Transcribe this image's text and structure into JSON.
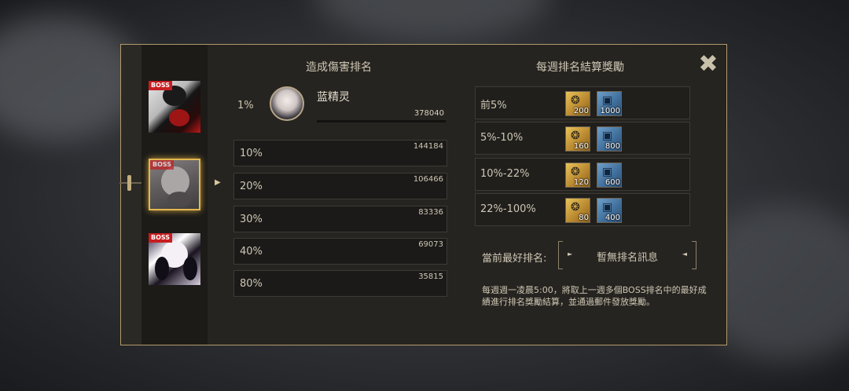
{
  "left_header": "造成傷害排名",
  "right_header": "每週排名結算獎勵",
  "close_symbol": "✖",
  "boss_tag": "BOSS",
  "top_player": {
    "rank": "1%",
    "name": "蓝精灵",
    "damage": "378040"
  },
  "ranks": [
    {
      "pct": "10%",
      "value": "144184"
    },
    {
      "pct": "20%",
      "value": "106466"
    },
    {
      "pct": "30%",
      "value": "83336"
    },
    {
      "pct": "40%",
      "value": "69073"
    },
    {
      "pct": "80%",
      "value": "35815"
    }
  ],
  "rewards": [
    {
      "label": "前5%",
      "gold_qty": "200",
      "blue_qty": "1000"
    },
    {
      "label": "5%-10%",
      "gold_qty": "160",
      "blue_qty": "800"
    },
    {
      "label": "10%-22%",
      "gold_qty": "120",
      "blue_qty": "600"
    },
    {
      "label": "22%-100%",
      "gold_qty": "80",
      "blue_qty": "400"
    }
  ],
  "item_icons": {
    "gold": "gold-chest-icon",
    "blue": "blue-crate-icon"
  },
  "best_rank": {
    "label": "當前最好排名:",
    "value": "暫無排名訊息"
  },
  "note": "每週週一凌晨5:00，將取上一週多個BOSS排名中的最好成績進行排名獎勵結算，並通過郵件發放獎勵。",
  "colors": {
    "accent_gold": "#e3b84e",
    "boss_tag": "#c71d21",
    "panel_border": "#b39a6a"
  }
}
